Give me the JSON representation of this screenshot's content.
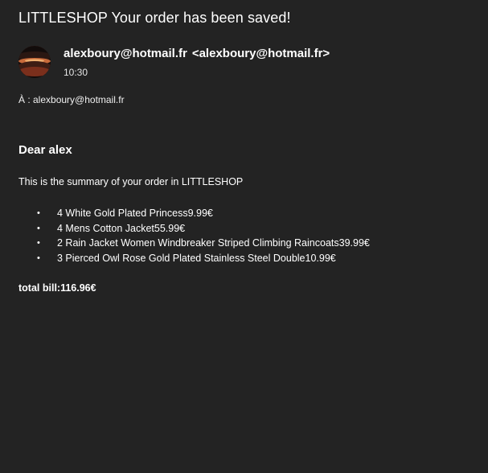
{
  "email": {
    "subject": "LITTLESHOP Your order has been saved!",
    "sender_name": "alexboury@hotmail.fr",
    "sender_address": "<alexboury@hotmail.fr>",
    "time": "10:30",
    "to_line": "À : alexboury@hotmail.fr",
    "avatar_icon": "sunset-photo-avatar"
  },
  "body": {
    "greeting": "Dear alex",
    "intro": "This is the summary of your order in LITTLESHOP",
    "items": [
      "4 White Gold Plated Princess9.99€",
      "4 Mens Cotton Jacket55.99€",
      "2 Rain Jacket Women Windbreaker Striped Climbing Raincoats39.99€",
      "3 Pierced Owl Rose Gold Plated Stainless Steel Double10.99€"
    ],
    "bullet": "•",
    "total": "total bill:116.96€"
  },
  "colors": {
    "background": "#232323",
    "text": "#ffffff"
  }
}
